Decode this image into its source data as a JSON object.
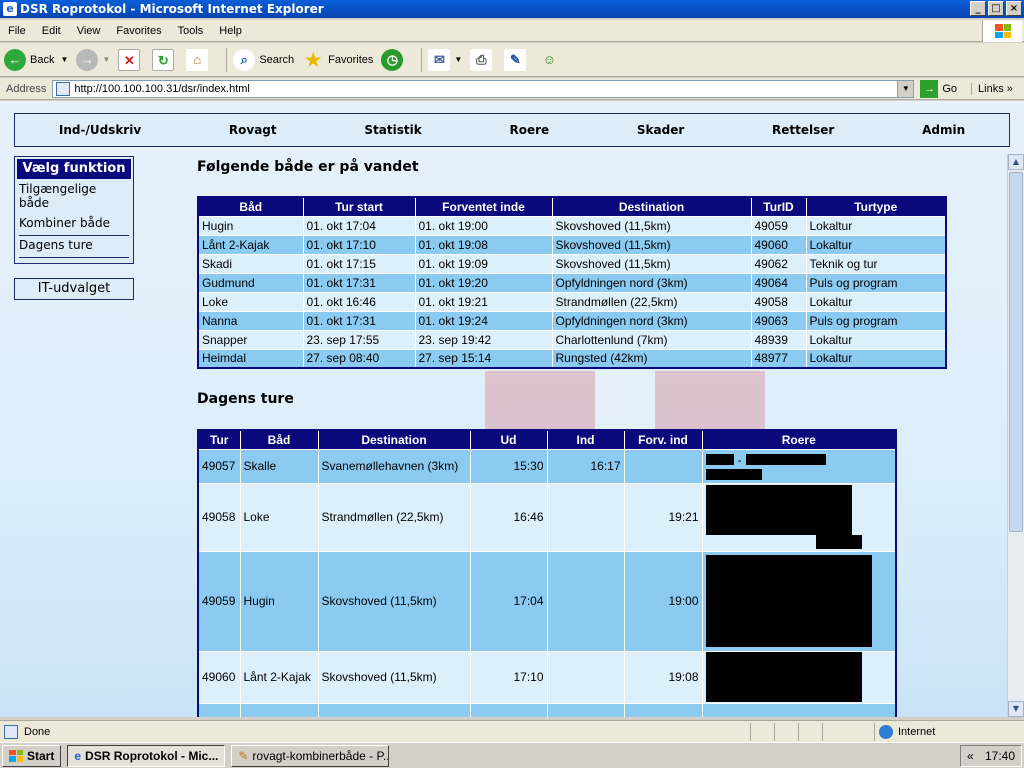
{
  "window": {
    "title": "DSR Roprotokol - Microsoft Internet Explorer",
    "buttons": [
      "_",
      "□",
      "×"
    ]
  },
  "menu": [
    "File",
    "Edit",
    "View",
    "Favorites",
    "Tools",
    "Help"
  ],
  "toolbar": {
    "back": "Back",
    "search": "Search",
    "favorites": "Favorites"
  },
  "address": {
    "label": "Address",
    "url": "http://100.100.100.31/dsr/index.html",
    "go": "Go",
    "links": "Links"
  },
  "nav": [
    "Ind-/Udskriv",
    "Rovagt",
    "Statistik",
    "Roere",
    "Skader",
    "Rettelser",
    "Admin"
  ],
  "sidebar": {
    "header": "Vælg funktion",
    "items": [
      "Tilgængelige både",
      "Kombiner både",
      "Dagens ture"
    ],
    "it_button": "IT-udvalget"
  },
  "section1": {
    "title": "Følgende både er på vandet",
    "columns": [
      "Båd",
      "Tur start",
      "Forventet inde",
      "Destination",
      "TurID",
      "Turtype"
    ],
    "rows": [
      [
        "Hugin",
        "01. okt 17:04",
        "01. okt 19:00",
        "Skovshoved (11,5km)",
        "49059",
        "Lokaltur"
      ],
      [
        "Lånt 2-Kajak",
        "01. okt 17:10",
        "01. okt 19:08",
        "Skovshoved (11,5km)",
        "49060",
        "Lokaltur"
      ],
      [
        "Skadi",
        "01. okt 17:15",
        "01. okt 19:09",
        "Skovshoved (11,5km)",
        "49062",
        "Teknik og tur"
      ],
      [
        "Gudmund",
        "01. okt 17:31",
        "01. okt 19:20",
        "Opfyldningen nord (3km)",
        "49064",
        "Puls og program"
      ],
      [
        "Loke",
        "01. okt 16:46",
        "01. okt 19:21",
        "Strandmøllen (22,5km)",
        "49058",
        "Lokaltur"
      ],
      [
        "Nanna",
        "01. okt 17:31",
        "01. okt 19:24",
        "Opfyldningen nord (3km)",
        "49063",
        "Puls og program"
      ],
      [
        "Snapper",
        "23. sep 17:55",
        "23. sep 19:42",
        "Charlottenlund (7km)",
        "48939",
        "Lokaltur"
      ],
      [
        "Heimdal",
        "27. sep 08:40",
        "27. sep 15:14",
        "Rungsted (42km)",
        "48977",
        "Lokaltur"
      ]
    ]
  },
  "section2": {
    "title": "Dagens ture",
    "columns": [
      "Tur",
      "Båd",
      "Destination",
      "Ud",
      "Ind",
      "Forv. ind",
      "Roere"
    ],
    "rows": [
      [
        "49057",
        "Skalle",
        "Svanemøllehavnen (3km)",
        "15:30",
        "16:17",
        ""
      ],
      [
        "49058",
        "Loke",
        "Strandmøllen (22,5km)",
        "16:46",
        "",
        "19:21"
      ],
      [
        "49059",
        "Hugin",
        "Skovshoved (11,5km)",
        "17:04",
        "",
        "19:00"
      ],
      [
        "49060",
        "Lånt 2-Kajak",
        "Skovshoved (11,5km)",
        "17:10",
        "",
        "19:08"
      ]
    ],
    "redaction_dash": "-"
  },
  "status": {
    "text": "Done",
    "zone": "Internet"
  },
  "taskbar": {
    "start": "Start",
    "tasks": [
      "DSR Roprotokol - Mic...",
      "rovagt-kombinerbåde - P..."
    ],
    "tray_arrow": "«",
    "time": "17:40"
  },
  "colors": {
    "header_navy": "#0a0a7d",
    "row_light": "#dcf0fb",
    "row_dark": "#8ccbf1"
  }
}
